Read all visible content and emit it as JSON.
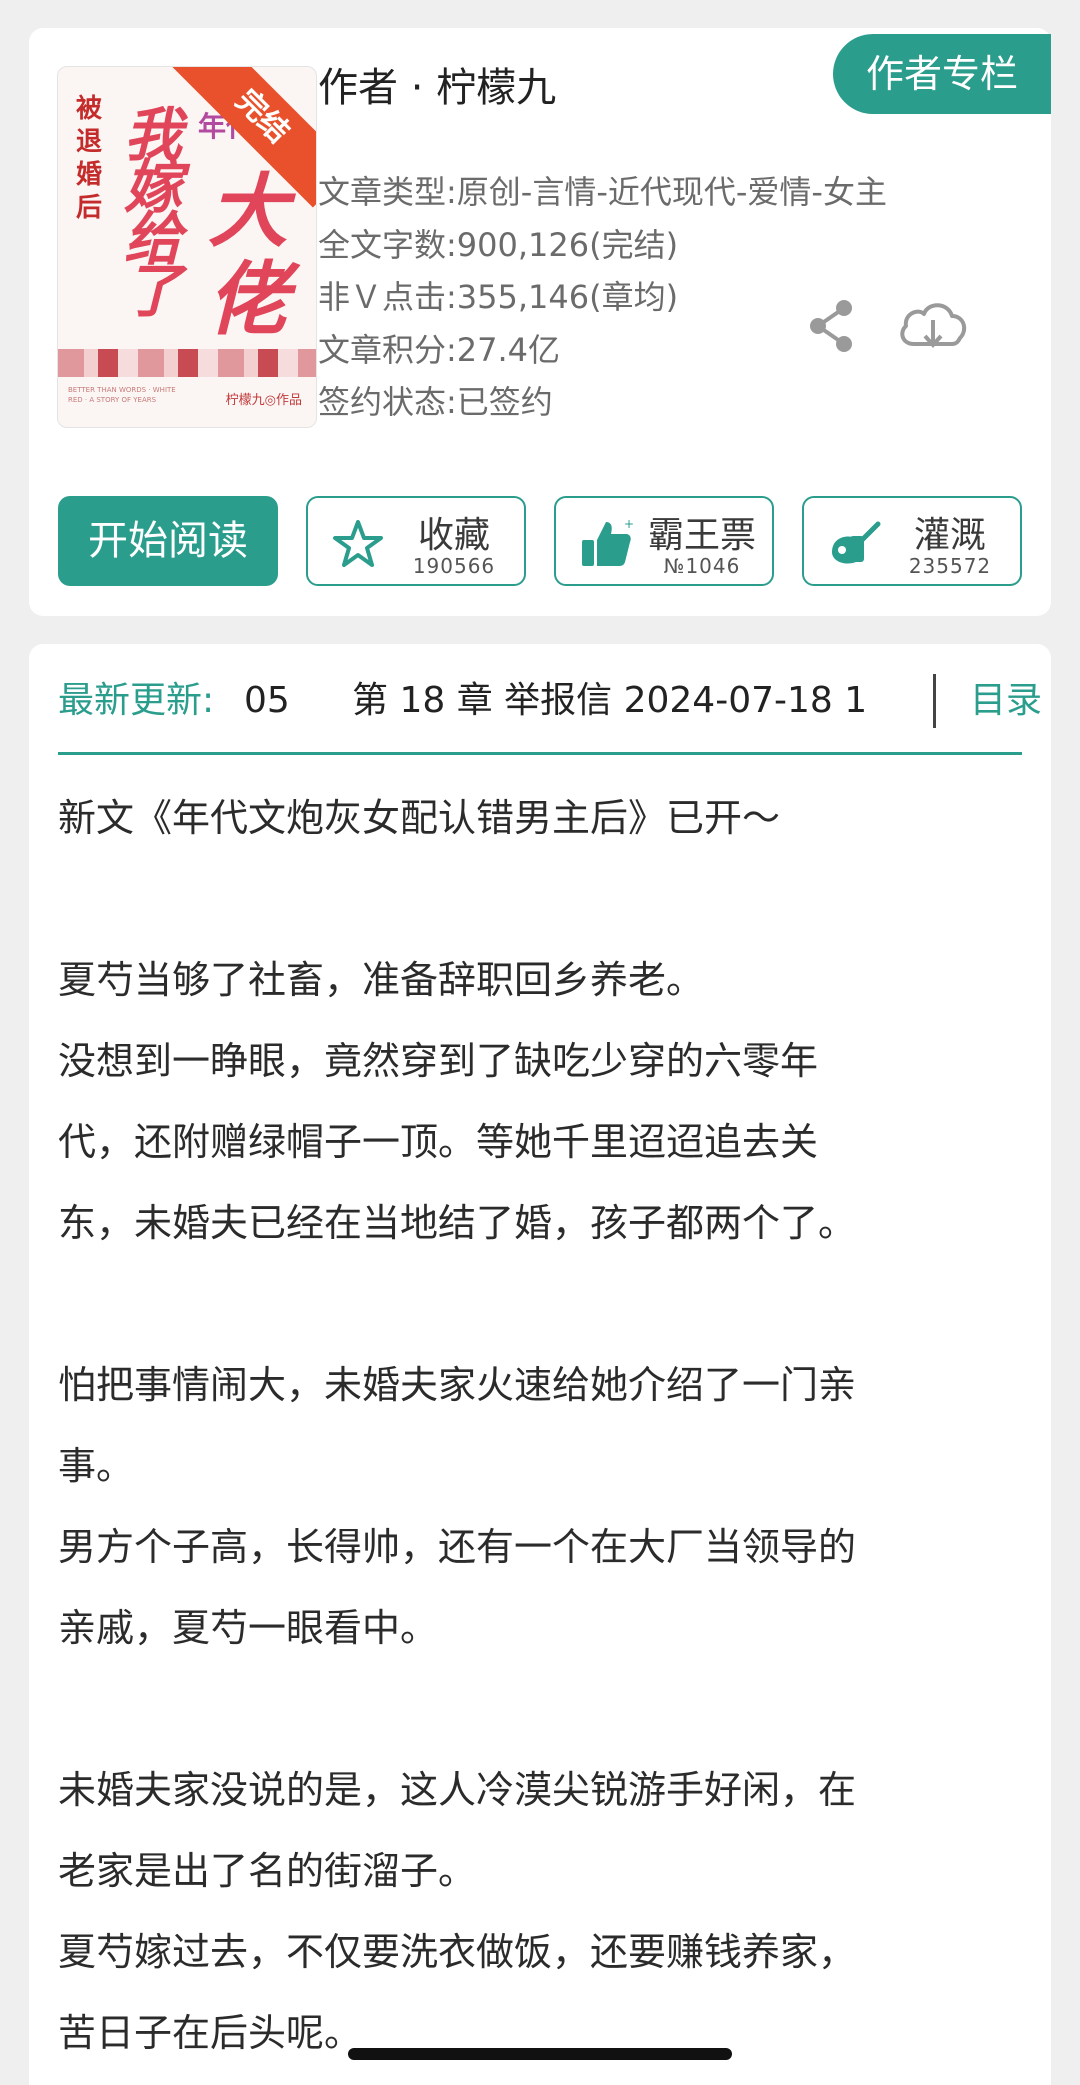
{
  "book": {
    "cover": {
      "ribbon": "完结",
      "small_title": "被退婚后",
      "tag": "年代文",
      "title_line1": "我嫁给了",
      "title_line2": "大佬",
      "author_mark": "柠檬九◎作品",
      "fine_print": "BETTER THAN WORDS · WHITE RED · A STORY OF YEARS"
    },
    "author_line": "作者 · 柠檬九",
    "author_column_button": "作者专栏",
    "meta": [
      "文章类型:原创-言情-近代现代-爱情-女主",
      "全文字数:900,126(完结)",
      "非Ｖ点击:355,146(章均)",
      "文章积分:27.4亿",
      "签约状态:已签约"
    ]
  },
  "actions": {
    "start_reading": "开始阅读",
    "favorite": {
      "label": "收藏",
      "count": "190566"
    },
    "vote": {
      "label": "霸王票",
      "count": "№1046"
    },
    "water": {
      "label": "灌溉",
      "count": "235572"
    }
  },
  "latest": {
    "label": "最新更新:",
    "num": "05",
    "chapter": "第 18 章 举报信 2024-07-18 1",
    "toc": "目录"
  },
  "description": [
    "新文《年代文炮灰女配认错男主后》已开～",
    "",
    "夏芍当够了社畜，准备辞职回乡养老。",
    "没想到一睁眼，竟然穿到了缺吃少穿的六零年",
    "代，还附赠绿帽子一顶。等她千里迢迢追去关",
    "东，未婚夫已经在当地结了婚，孩子都两个了。",
    "",
    "怕把事情闹大，未婚夫家火速给她介绍了一门亲",
    "事。",
    "男方个子高，长得帅，还有一个在大厂当领导的",
    "亲戚，夏芍一眼看中。",
    "",
    "未婚夫家没说的是，这人冷漠尖锐游手好闲，在",
    "老家是出了名的街溜子。",
    "夏芍嫁过去，不仅要洗衣做饭，还要赚钱养家，",
    "苦日子在后头呢。"
  ],
  "colors": {
    "accent": "#2a9d8d",
    "cover_red": "#e0455a",
    "ribbon": "#e8512c"
  },
  "icons": [
    "share-icon",
    "download-cloud-icon",
    "star-icon",
    "thumbs-up-icon",
    "watering-can-icon"
  ]
}
